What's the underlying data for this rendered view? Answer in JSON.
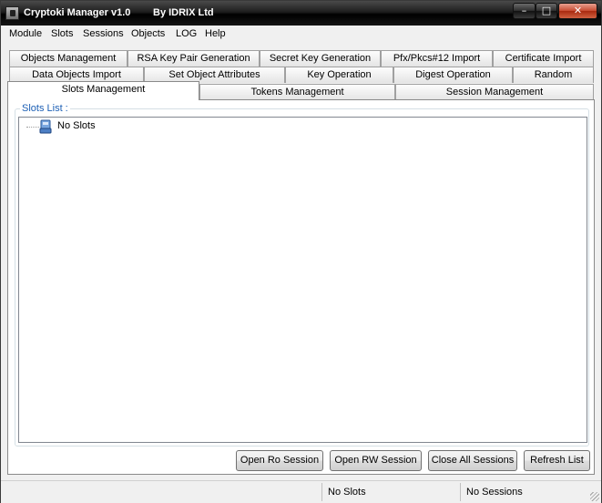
{
  "window": {
    "title": "Cryptoki Manager v1.0",
    "subtitle": "By IDRIX Ltd",
    "controls": {
      "minimize": "–",
      "maximize": "□",
      "close": "✕"
    }
  },
  "menu": [
    "Module",
    "Slots",
    "Sessions",
    "Objects",
    "LOG",
    "Help"
  ],
  "tabs": {
    "row1": [
      "Objects Management",
      "RSA Key Pair Generation",
      "Secret Key Generation",
      "Pfx/Pkcs#12 Import",
      "Certificate Import"
    ],
    "row2": [
      "Data Objects Import",
      "Set Object Attributes",
      "Key Operation",
      "Digest Operation",
      "Random"
    ],
    "row3": [
      "Slots Management",
      "Tokens Management",
      "Session Management"
    ],
    "active": "Slots Management"
  },
  "slots_panel": {
    "group_label": "Slots List :",
    "tree_items": [
      {
        "label": "No Slots",
        "icon": "smartcard-reader-icon"
      }
    ]
  },
  "buttons": {
    "open_ro": "Open Ro Session",
    "open_rw": "Open RW Session",
    "close_all": "Close All Sessions",
    "refresh": "Refresh List"
  },
  "status": {
    "slots": "No Slots",
    "sessions": "No Sessions"
  },
  "colors": {
    "group_label": "#1c5fb5",
    "titlebar": "#000000",
    "close_button": "#c84a30"
  }
}
